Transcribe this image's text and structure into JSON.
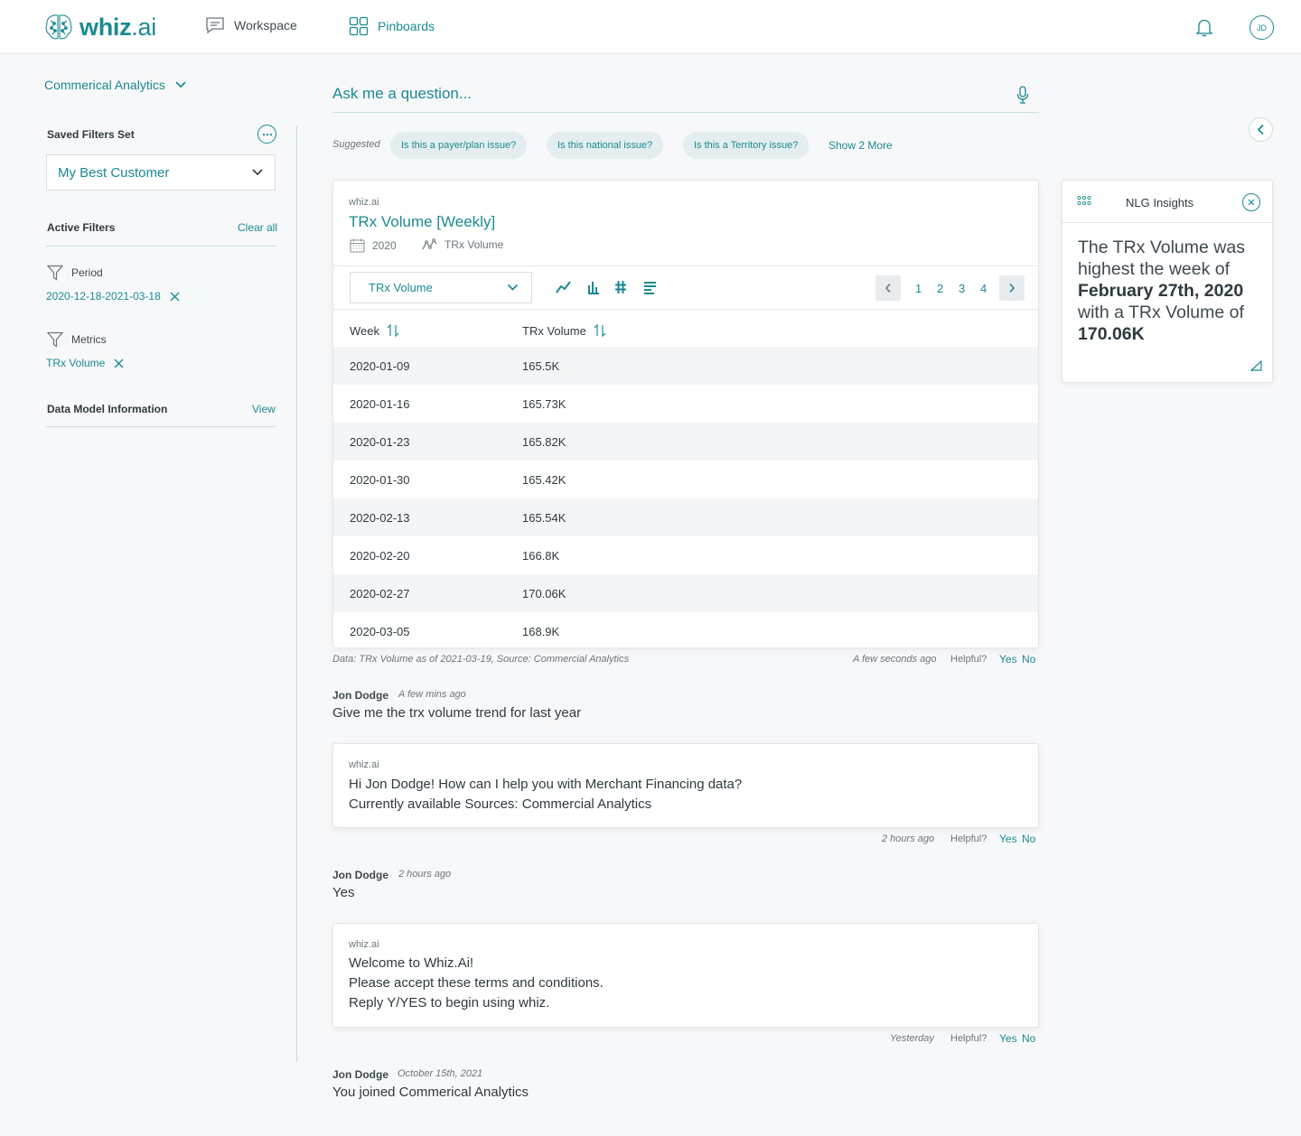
{
  "app": {
    "logo_text": "whiz",
    "logo_suffix": ".ai"
  },
  "nav": {
    "workspace": "Workspace",
    "pinboards": "Pinboards",
    "avatar_initials": "JD"
  },
  "sidebar": {
    "data_source": "Commerical Analytics",
    "saved_filters_label": "Saved Filters Set",
    "saved_filter_value": "My Best Customer",
    "active_filters_label": "Active Filters",
    "clear_all": "Clear all",
    "filters": [
      {
        "title": "Period",
        "value": "2020-12-18-2021-03-18"
      },
      {
        "title": "Metrics",
        "value": "TRx Volume"
      }
    ],
    "data_model_label": "Data Model Information",
    "data_model_view": "View"
  },
  "ask": {
    "placeholder": "Ask me a question..."
  },
  "suggestions": {
    "label": "Suggested",
    "chips": [
      "Is this a payer/plan issue?",
      "Is this  national issue?",
      "Is this a Territory issue?"
    ],
    "show_more": "Show 2 More"
  },
  "result": {
    "source": "whiz.ai",
    "title": "TRx Volume [Weekly]",
    "year": "2020",
    "metric": "TRx Volume",
    "metric_select": "TRx Volume",
    "pages": [
      "1",
      "2",
      "3",
      "4"
    ],
    "columns": [
      "Week",
      "TRx Volume"
    ],
    "rows": [
      [
        "2020-01-09",
        "165.5K"
      ],
      [
        "2020-01-16",
        "165.73K"
      ],
      [
        "2020-01-23",
        "165.82K"
      ],
      [
        "2020-01-30",
        "165.42K"
      ],
      [
        "2020-02-13",
        "165.54K"
      ],
      [
        "2020-02-20",
        "166.8K"
      ],
      [
        "2020-02-27",
        "170.06K"
      ],
      [
        "2020-03-05",
        "168.9K"
      ]
    ],
    "footnote": "Data: TRx Volume as of 2021-03-19, Source: Commercial Analytics",
    "time": "A few seconds ago"
  },
  "feedback": {
    "helpful": "Helpful?",
    "yes": "Yes",
    "no": "No"
  },
  "conversation": {
    "msg1": {
      "author": "Jon Dodge",
      "time": "A few mins ago",
      "text": "Give me the trx volume trend for last year"
    },
    "bot1": {
      "source": "whiz.ai",
      "lines": [
        "Hi Jon Dodge! How can I help you with Merchant Financing data?",
        "Currently available Sources: Commercial Analytics"
      ],
      "time": "2 hours ago"
    },
    "msg2": {
      "author": "Jon Dodge",
      "time": "2 hours  ago",
      "text": "Yes"
    },
    "bot2": {
      "source": "whiz.ai",
      "lines": [
        "Welcome to Whiz.Ai!",
        "Please accept these terms and conditions.",
        "Reply Y/YES to begin using whiz."
      ],
      "time": "Yesterday"
    },
    "msg3": {
      "author": "Jon Dodge",
      "time": "October 15th, 2021",
      "text": "You joined Commerical Analytics"
    }
  },
  "nlg": {
    "title": "NLG Insights",
    "text_1": "The TRx Volume was highest the week of ",
    "date": "February 27th, 2020",
    "text_2": " with a TRx Volume of ",
    "value": "170.06K"
  },
  "colors": {
    "accent": "#1b8a91",
    "background": "#f7f8fa",
    "chip_bg": "#e4eef0"
  }
}
